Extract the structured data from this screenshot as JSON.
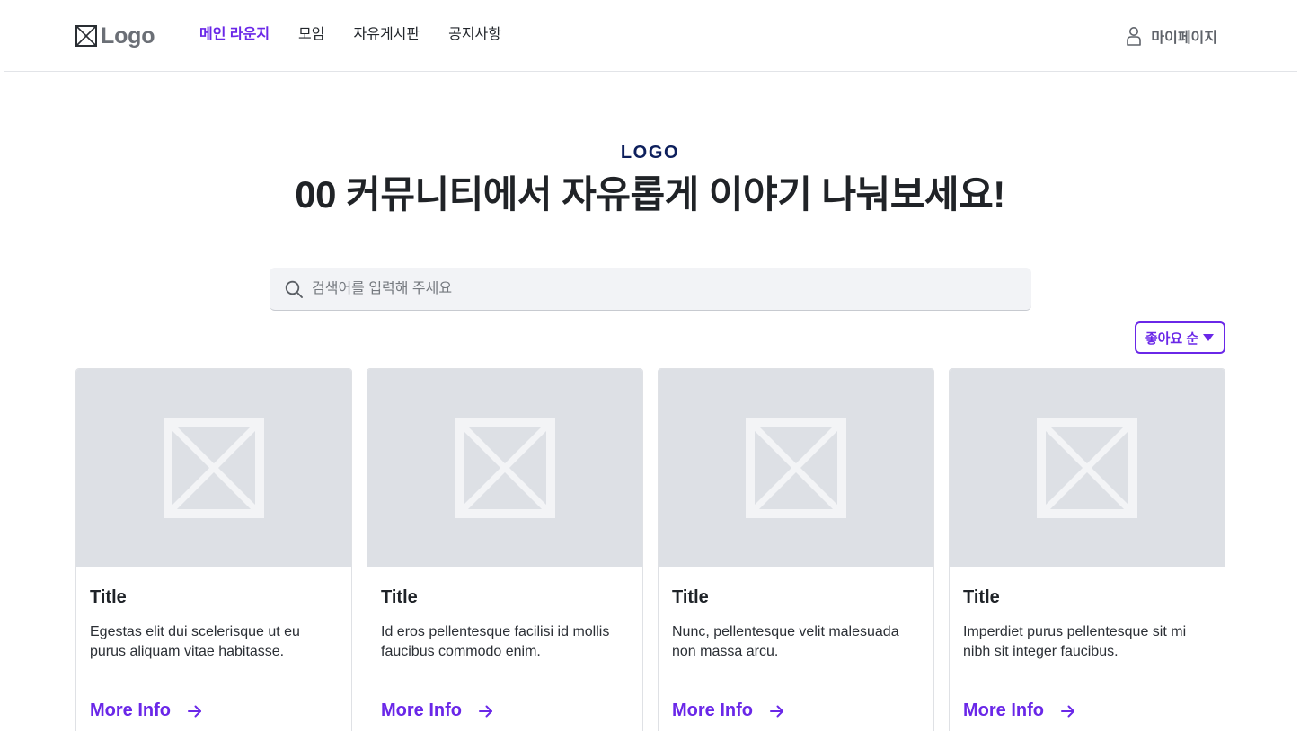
{
  "header": {
    "logo_text": "Logo",
    "nav": [
      {
        "label": "메인 라운지",
        "active": true
      },
      {
        "label": "모임",
        "active": false
      },
      {
        "label": "자유게시판",
        "active": false
      },
      {
        "label": "공지사항",
        "active": false
      }
    ],
    "mypage_label": "마이페이지"
  },
  "hero": {
    "eyebrow": "LOGO",
    "title": "00 커뮤니티에서 자유롭게 이야기 나눠보세요!"
  },
  "search": {
    "placeholder": "검색어를 입력해 주세요",
    "value": ""
  },
  "sort": {
    "selected": "좋아요 순"
  },
  "cards": [
    {
      "title": "Title",
      "description": "Egestas elit dui scelerisque ut eu purus aliquam vitae habitasse.",
      "link": "More Info"
    },
    {
      "title": "Title",
      "description": "Id eros pellentesque facilisi id mollis faucibus commodo enim.",
      "link": "More Info"
    },
    {
      "title": "Title",
      "description": "Nunc, pellentesque velit malesuada non massa arcu.",
      "link": "More Info"
    },
    {
      "title": "Title",
      "description": "Imperdiet purus pellentesque sit mi nibh sit integer faucibus.",
      "link": "More Info"
    }
  ],
  "colors": {
    "accent": "#6a27e8",
    "eyebrow": "#0d1f5c",
    "image_placeholder": "#dde0e5",
    "search_bg": "#f2f3f6"
  },
  "icons": {
    "logo": "image-placeholder-icon",
    "mypage": "user-icon",
    "search": "search-icon",
    "sort": "caret-down-icon",
    "card_image": "image-placeholder-icon",
    "card_link": "arrow-right-icon"
  }
}
